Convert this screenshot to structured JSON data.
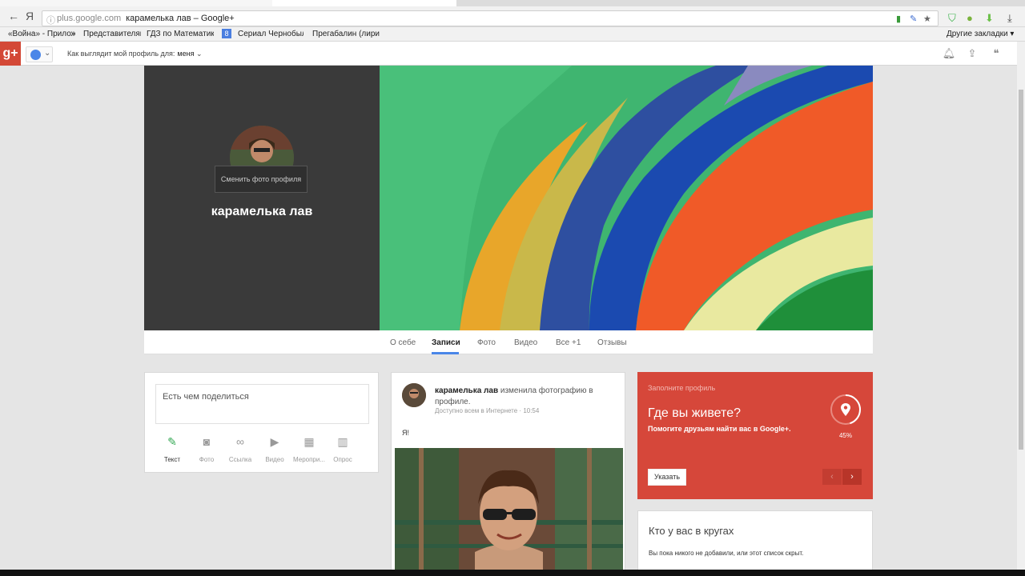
{
  "browser": {
    "domain": "plus.google.com",
    "page_title": "карамелька лав – Google+",
    "back_glyph": "←",
    "yandex_glyph": "Я",
    "bookmarks": [
      {
        "label": "«Война» - Приложе"
      },
      {
        "label": "Представителям"
      },
      {
        "label": "ГДЗ по Математике"
      },
      {
        "label": "Сериал Чернобыль"
      },
      {
        "label": "Прегабалин (лирика"
      }
    ],
    "other_bookmarks": "Другие закладки ▾"
  },
  "gplus": {
    "logo": "g+",
    "view_as_label": "Как выглядит мой профиль для:",
    "view_as_value": "меня"
  },
  "profile": {
    "name": "карамелька лав",
    "change_photo": "Сменить фото профиля"
  },
  "tabs": [
    {
      "label": "О себе"
    },
    {
      "label": "Записи",
      "active": true
    },
    {
      "label": "Фото"
    },
    {
      "label": "Видео"
    },
    {
      "label": "Все +1"
    },
    {
      "label": "Отзывы"
    }
  ],
  "share": {
    "placeholder": "Есть чем поделиться",
    "options": [
      {
        "label": "Текст",
        "icon": "pencil-icon",
        "glyph": "✎"
      },
      {
        "label": "Фото",
        "icon": "camera-icon",
        "glyph": "◙"
      },
      {
        "label": "Ссылка",
        "icon": "link-icon",
        "glyph": "∞"
      },
      {
        "label": "Видео",
        "icon": "video-icon",
        "glyph": "▶"
      },
      {
        "label": "Меропри...",
        "icon": "event-icon",
        "glyph": "▦"
      },
      {
        "label": "Опрос",
        "icon": "poll-icon",
        "glyph": "▥"
      }
    ]
  },
  "post": {
    "author": "карамелька лав",
    "action": "изменила фотографию в профиле.",
    "visibility": "Доступно всем в Интернете",
    "time": "10:54",
    "text": "Я!"
  },
  "fill_profile": {
    "kicker": "Заполните профиль",
    "question": "Где вы живете?",
    "help": "Помогите друзьям найти вас в Google+.",
    "percent": "45%",
    "progress": 0.45,
    "button": "Указать"
  },
  "circles": {
    "title": "Кто у вас в кругах",
    "text": "Вы пока никого не добавили, или этот список скрыт."
  },
  "colors": {
    "accent": "#4a86e8",
    "gplus_red": "#d34836",
    "card_red": "#d6473a"
  }
}
